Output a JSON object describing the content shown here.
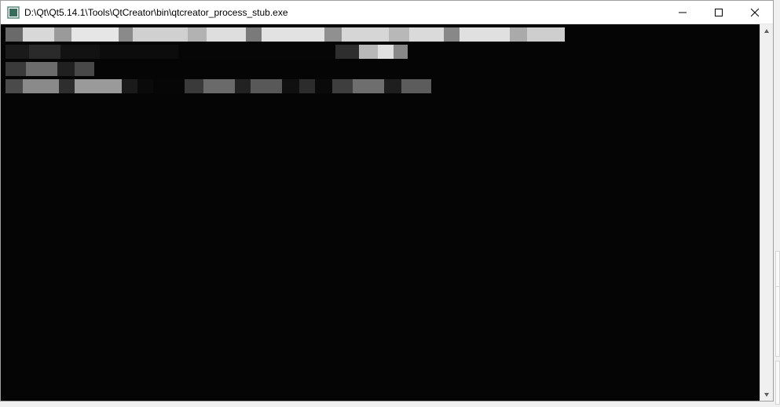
{
  "window": {
    "title": "D:\\Qt\\Qt5.14.1\\Tools\\QtCreator\\bin\\qtcreator_process_stub.exe"
  },
  "controls": {
    "minimize": "Minimize",
    "maximize": "Maximize",
    "close": "Close"
  },
  "scrollbar": {
    "up": "Scroll up",
    "down": "Scroll down"
  }
}
